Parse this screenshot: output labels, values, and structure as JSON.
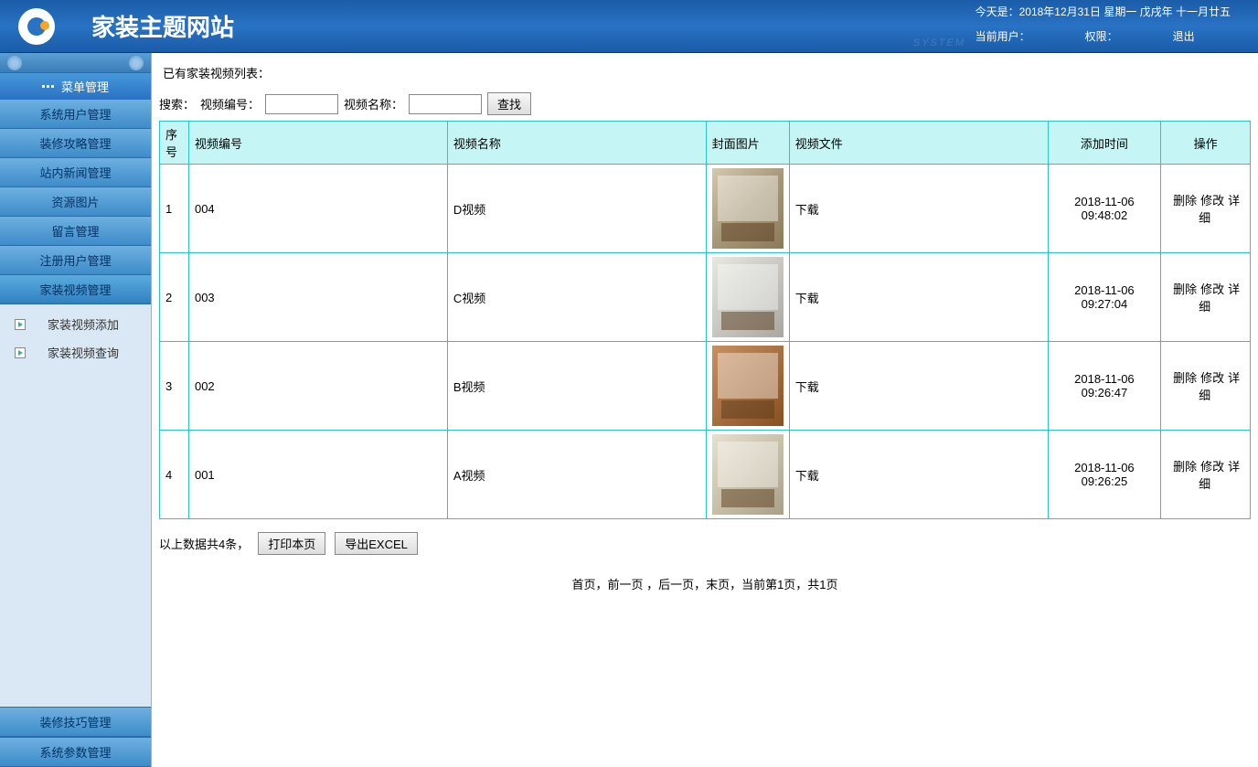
{
  "header": {
    "site_title": "家装主题网站",
    "date_text": "今天是：2018年12月31日 星期一 戊戌年 十一月廿五",
    "current_user_label": "当前用户：",
    "permission_label": "权限：",
    "logout_label": "退出",
    "watermark": "SYSTEM"
  },
  "sidebar": {
    "menu_title": "菜单管理",
    "items": [
      "系统用户管理",
      "装修攻略管理",
      "站内新闻管理",
      "资源图片",
      "留言管理",
      "注册用户管理",
      "家装视频管理"
    ],
    "sub_items": [
      "家装视频添加",
      "家装视频查询"
    ],
    "bottom_items": [
      "装修技巧管理",
      "系统参数管理"
    ]
  },
  "main": {
    "list_title": "已有家装视频列表：",
    "search_label": "搜索：",
    "code_label": "视频编号：",
    "name_label": "视频名称：",
    "search_btn": "查找",
    "columns": {
      "seq": "序号",
      "code": "视频编号",
      "name": "视频名称",
      "cover": "封面图片",
      "file": "视频文件",
      "time": "添加时间",
      "op": "操作"
    },
    "rows": [
      {
        "seq": "1",
        "code": "004",
        "name": "D视频",
        "file": "下载",
        "time": "2018-11-06 09:48:02"
      },
      {
        "seq": "2",
        "code": "003",
        "name": "C视频",
        "file": "下载",
        "time": "2018-11-06 09:27:04"
      },
      {
        "seq": "3",
        "code": "002",
        "name": "B视频",
        "file": "下载",
        "time": "2018-11-06 09:26:47"
      },
      {
        "seq": "4",
        "code": "001",
        "name": "A视频",
        "file": "下载",
        "time": "2018-11-06 09:26:25"
      }
    ],
    "ops": {
      "delete": "删除",
      "edit": "修改",
      "detail": "详细"
    },
    "footer_count": "以上数据共4条，",
    "print_btn": "打印本页",
    "excel_btn": "导出EXCEL",
    "pagination": "首页，前一页 ，后一页，末页，当前第1页，共1页"
  }
}
